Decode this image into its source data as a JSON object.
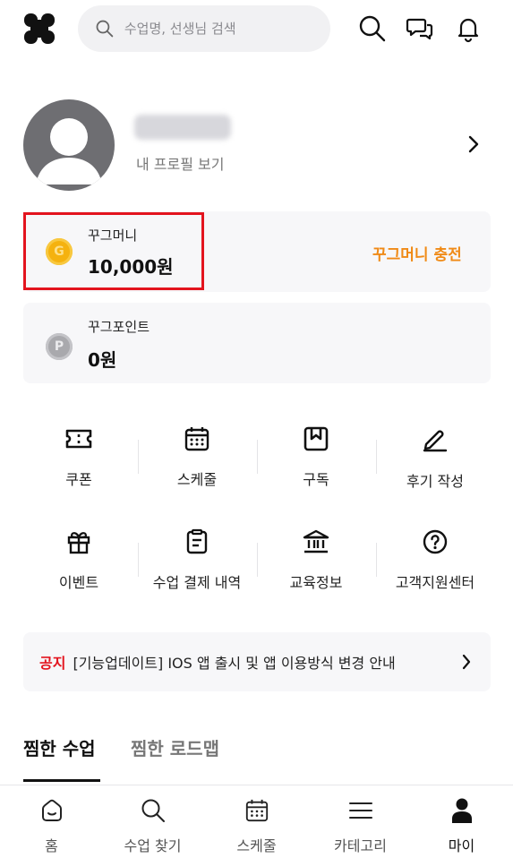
{
  "header": {
    "search_placeholder": "수업명, 선생님 검색",
    "icons": [
      "search-icon",
      "chat-icon",
      "bell-icon"
    ]
  },
  "profile": {
    "link_label": "내 프로필 보기"
  },
  "money": {
    "label": "꾸그머니",
    "value": "10,000원",
    "coin_symbol": "G",
    "charge_label": "꾸그머니 충전",
    "accent_color": "#f08a16"
  },
  "points": {
    "label": "꾸그포인트",
    "value": "0원",
    "coin_symbol": "P"
  },
  "menu": {
    "row1": [
      {
        "label": "쿠폰",
        "icon": "ticket-icon"
      },
      {
        "label": "스케줄",
        "icon": "calendar-icon"
      },
      {
        "label": "구독",
        "icon": "subscribe-icon"
      },
      {
        "label": "후기 작성",
        "icon": "pencil-icon"
      }
    ],
    "row2": [
      {
        "label": "이벤트",
        "icon": "gift-icon"
      },
      {
        "label": "수업 결제 내역",
        "icon": "receipt-icon"
      },
      {
        "label": "교육정보",
        "icon": "institution-icon"
      },
      {
        "label": "고객지원센터",
        "icon": "help-icon"
      }
    ]
  },
  "notice": {
    "tag": "공지",
    "text": "[기능업데이트] IOS 앱 출시 및 앱 이용방식 변경 안내",
    "tag_color": "#e3141e"
  },
  "tabs": [
    {
      "label": "찜한 수업",
      "active": true
    },
    {
      "label": "찜한 로드맵",
      "active": false
    }
  ],
  "bottom_nav": [
    {
      "label": "홈",
      "icon": "home-icon"
    },
    {
      "label": "수업 찾기",
      "icon": "search-icon"
    },
    {
      "label": "스케줄",
      "icon": "calendar-icon"
    },
    {
      "label": "카테고리",
      "icon": "menu-icon"
    },
    {
      "label": "마이",
      "icon": "user-icon",
      "active": true
    }
  ]
}
